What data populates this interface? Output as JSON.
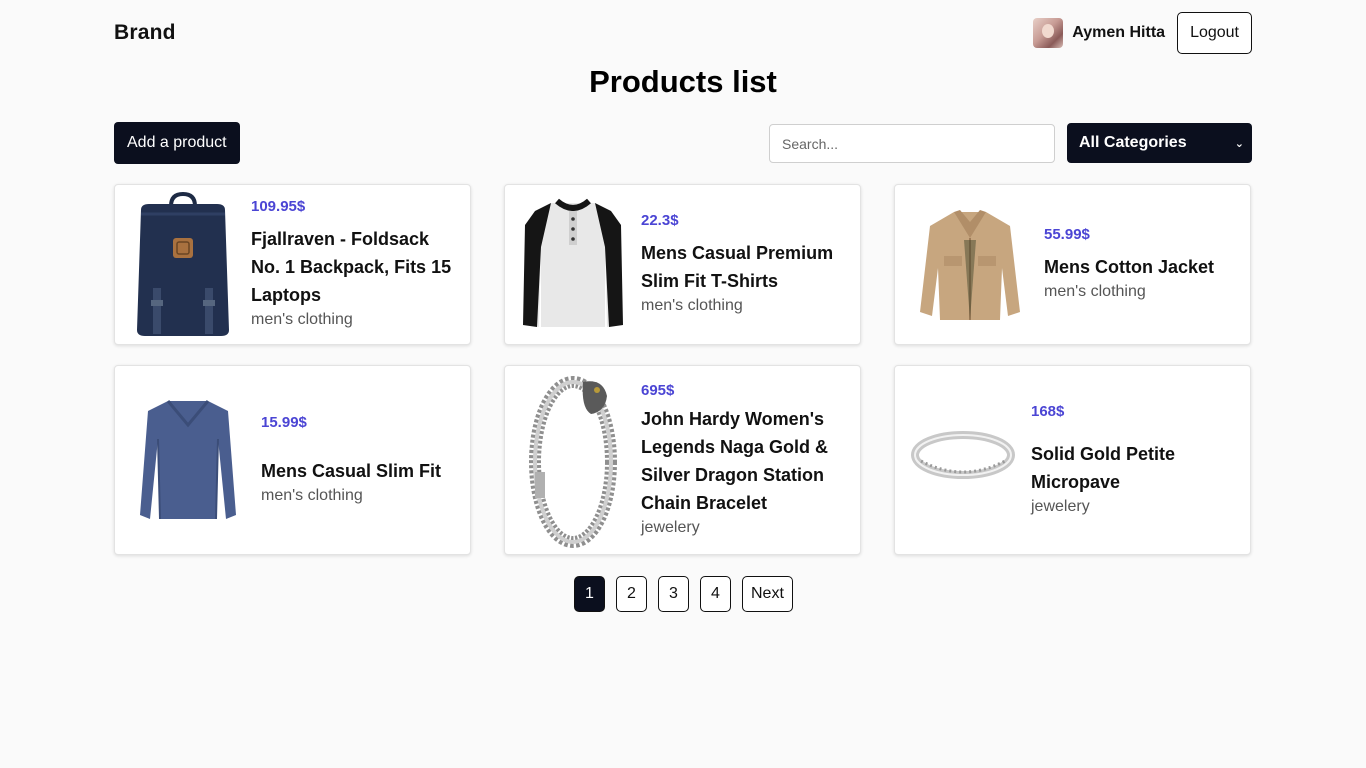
{
  "header": {
    "brand": "Brand",
    "user_name": "Aymen Hitta",
    "logout_label": "Logout"
  },
  "page_title": "Products list",
  "toolbar": {
    "add_label": "Add a product",
    "search_placeholder": "Search...",
    "category_selected": "All Categories"
  },
  "products": [
    {
      "price": "109.95$",
      "title": "Fjallraven - Foldsack No. 1 Backpack, Fits 15 Laptops",
      "category": "men's clothing",
      "icon": "backpack-image"
    },
    {
      "price": "22.3$",
      "title": "Mens Casual Premium Slim Fit T-Shirts",
      "category": "men's clothing",
      "icon": "tshirt-image"
    },
    {
      "price": "55.99$",
      "title": "Mens Cotton Jacket",
      "category": "men's clothing",
      "icon": "jacket-image"
    },
    {
      "price": "15.99$",
      "title": "Mens Casual Slim Fit",
      "category": "men's clothing",
      "icon": "longsleeve-image"
    },
    {
      "price": "695$",
      "title": "John Hardy Women's Legends Naga Gold & Silver Dragon Station Chain Bracelet",
      "category": "jewelery",
      "icon": "bracelet-image"
    },
    {
      "price": "168$",
      "title": "Solid Gold Petite Micropave",
      "category": "jewelery",
      "icon": "ring-image"
    }
  ],
  "pagination": {
    "pages": [
      "1",
      "2",
      "3",
      "4"
    ],
    "active": "1",
    "next_label": "Next"
  },
  "colors": {
    "accent_price": "#4b45d4",
    "dark_button": "#0b0f1e"
  }
}
